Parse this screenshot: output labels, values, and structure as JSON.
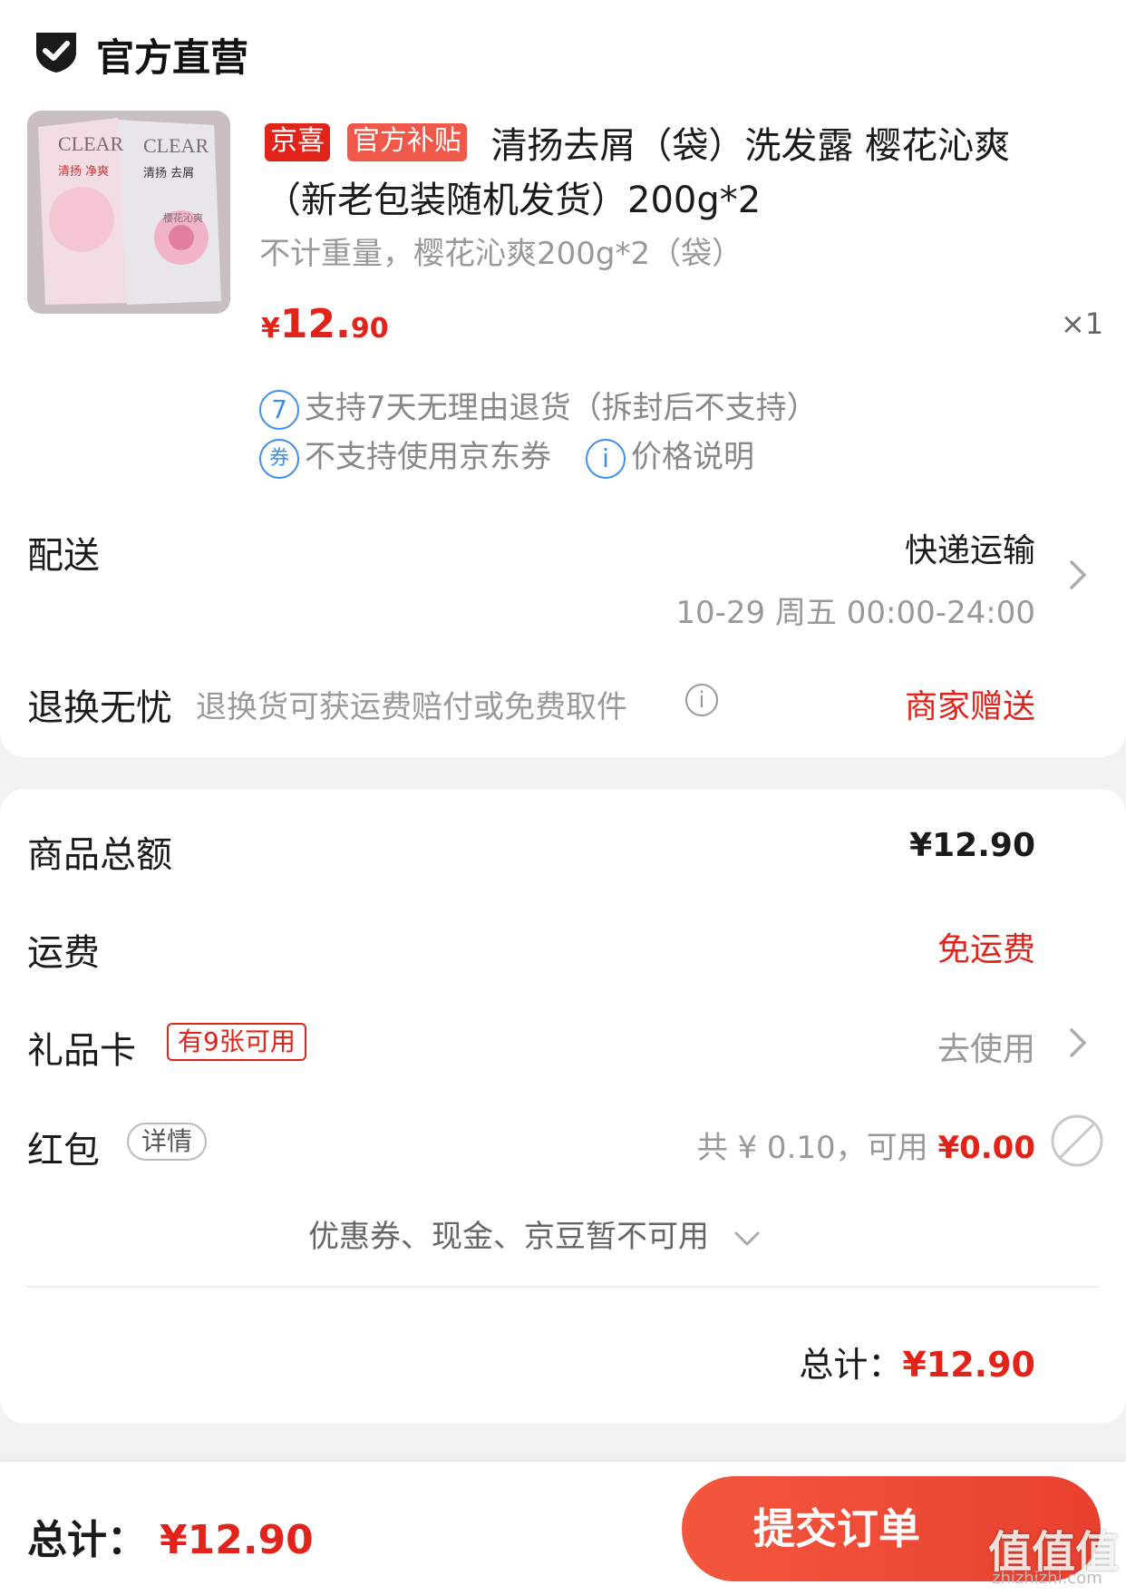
{
  "shop": {
    "name": "官方直营",
    "icon": "shield-check-icon"
  },
  "product": {
    "tag_jx": "京喜",
    "tag_subsidy": "官方补贴",
    "title_line1": "清扬去屑（袋）洗发露 樱花沁爽",
    "title_line2": "（新老包装随机发货）200g*2",
    "spec": "不计重量，樱花沁爽200g*2（袋）",
    "price_symbol": "¥",
    "price_int": "12.",
    "price_dec": "90",
    "qty": "×1",
    "image": {
      "brand": "CLEAR",
      "label_left": "清扬",
      "label_left_2": "净爽",
      "label_right": "清扬",
      "label_right_2": "去屑",
      "flower_text": "樱花沁爽"
    },
    "services": [
      {
        "icon_text": "7",
        "text": "支持7天无理由退货（拆封后不支持）"
      },
      {
        "icon_text": "券",
        "text": "不支持使用京东券"
      },
      {
        "icon_text": "i",
        "text": "价格说明"
      }
    ]
  },
  "delivery": {
    "label": "配送",
    "method": "快递运输",
    "time": "10-29 周五 00:00-24:00"
  },
  "return": {
    "label": "退换无忧",
    "desc": "退换货可获运费赔付或免费取件",
    "value": "商家赠送"
  },
  "summary": {
    "goods_total_label": "商品总额",
    "goods_total_value": "¥12.90",
    "shipping_label": "运费",
    "shipping_value": "免运费",
    "gift_card_label": "礼品卡",
    "gift_card_badge": "有9张可用",
    "gift_card_action": "去使用",
    "redpacket_label": "红包",
    "redpacket_detail": "详情",
    "redpacket_total": "共 ¥ 0.10，可用 ",
    "redpacket_available": "¥0.00",
    "unavailable_note": "优惠券、现金、京豆暂不可用",
    "total_label": "总计：",
    "total_value": "¥12.90"
  },
  "footer": {
    "total_label": "总计：",
    "total_value": "¥12.90",
    "submit_label": "提交订单"
  },
  "watermark": {
    "main": "值值值",
    "sub": "zhizhizhi.com"
  },
  "colors": {
    "accent_red": "#e2231a",
    "blue": "#3d8ef0",
    "button": "#f0503a"
  }
}
